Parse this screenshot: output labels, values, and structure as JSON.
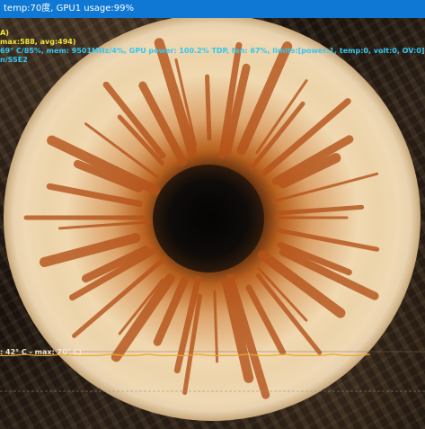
{
  "window": {
    "title": "temp:70度, GPU1 usage:99%"
  },
  "osd": {
    "line1": "A)",
    "line2": "max:588, avg:494)",
    "line3": "69° C/85%, mem: 9501MHz/4%, GPU power: 100.2% TDP, fan: 67%, limits:[power:1, temp:0, volt:0, OV:0]",
    "line4": "n/SSE2"
  },
  "monitor_graph": {
    "label": ": 42° C - max: 70° C)",
    "line_color": "#f0a530",
    "values": [
      69,
      69,
      70,
      69,
      69,
      70,
      69,
      69,
      69,
      70,
      69,
      69,
      70,
      69,
      69,
      69,
      70,
      69,
      69,
      69,
      70,
      69,
      69,
      70,
      69,
      69,
      69,
      70,
      69,
      69,
      70
    ]
  },
  "colors": {
    "titlebar": "#0f78d4",
    "osd_yellow": "#f2e63a",
    "osd_cyan": "#35c6ef",
    "fur_light": "#f1ddb8",
    "fur_orange": "#c9641c",
    "pupil": "#0e0b09"
  }
}
